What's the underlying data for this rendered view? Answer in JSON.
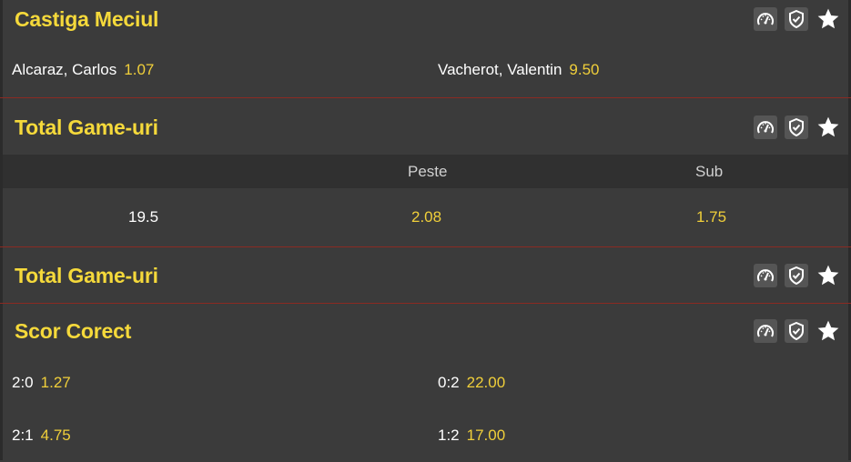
{
  "markets": {
    "m1": {
      "title": "Castiga Meciul",
      "home_name": "Alcaraz, Carlos",
      "home_odd": "1.07",
      "away_name": "Vacherot, Valentin",
      "away_odd": "9.50"
    },
    "m2": {
      "title": "Total Game-uri",
      "col_over": "Peste",
      "col_under": "Sub",
      "line": "19.5",
      "over_odd": "2.08",
      "under_odd": "1.75"
    },
    "m3": {
      "title": "Total Game-uri"
    },
    "m4": {
      "title": "Scor Corect",
      "rows": [
        {
          "left_score": "2:0",
          "left_odd": "1.27",
          "right_score": "0:2",
          "right_odd": "22.00"
        },
        {
          "left_score": "2:1",
          "left_odd": "4.75",
          "right_score": "1:2",
          "right_odd": "17.00"
        }
      ]
    }
  },
  "icons": {
    "stats": "speedometer-icon",
    "shield": "shield-check-icon",
    "favorite": "star-icon"
  },
  "colors": {
    "accent": "#f5d93b",
    "odd": "#f0cf3a",
    "separator": "#8b2a22",
    "bg": "#3b3b3b"
  }
}
